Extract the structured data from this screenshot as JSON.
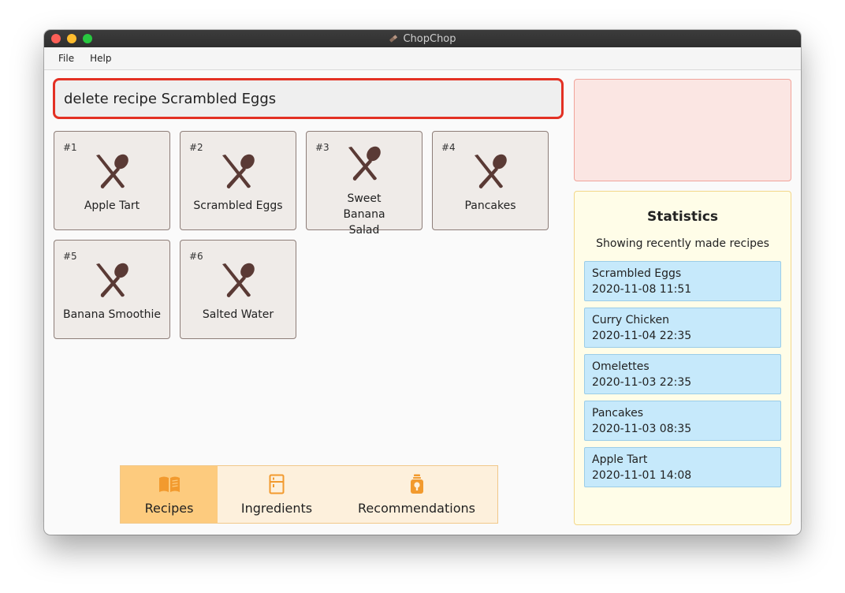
{
  "window": {
    "title": "ChopChop"
  },
  "menu": {
    "file": "File",
    "help": "Help"
  },
  "command": {
    "value": "delete recipe Scrambled Eggs"
  },
  "recipes": [
    {
      "num": "#1",
      "name": "Apple Tart"
    },
    {
      "num": "#2",
      "name": "Scrambled Eggs"
    },
    {
      "num": "#3",
      "name": "Sweet Banana Salad"
    },
    {
      "num": "#4",
      "name": "Pancakes"
    },
    {
      "num": "#5",
      "name": "Banana Smoothie"
    },
    {
      "num": "#6",
      "name": "Salted Water"
    }
  ],
  "tabs": [
    {
      "label": "Recipes",
      "icon": "book-icon",
      "active": true
    },
    {
      "label": "Ingredients",
      "icon": "fridge-icon",
      "active": false
    },
    {
      "label": "Recommendations",
      "icon": "lightbulb-icon",
      "active": false
    }
  ],
  "stats": {
    "title": "Statistics",
    "subtitle": "Showing recently made recipes",
    "entries": [
      {
        "name": "Scrambled Eggs",
        "time": "2020-11-08 11:51"
      },
      {
        "name": "Curry Chicken",
        "time": "2020-11-04 22:35"
      },
      {
        "name": "Omelettes",
        "time": "2020-11-03 22:35"
      },
      {
        "name": "Pancakes",
        "time": "2020-11-03 08:35"
      },
      {
        "name": "Apple Tart",
        "time": "2020-11-01 14:08"
      }
    ]
  },
  "colors": {
    "accent": "#e33124",
    "icon": "#5a3a35",
    "tab_icon": "#f29a2e",
    "tab_active": "#fdcb7e"
  }
}
